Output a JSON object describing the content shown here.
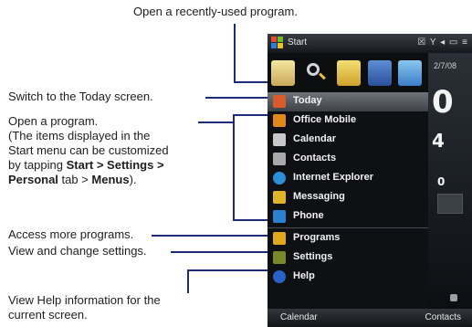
{
  "annotations": {
    "recent": "Open a recently-used program.",
    "today": "Switch to the Today screen.",
    "open_program": {
      "l1": "Open a program.",
      "l2": "(The items displayed in the",
      "l3": "Start menu can be customized",
      "l4_a": "by tapping ",
      "l4_b": "Start > Settings >",
      "l5_a": "Personal",
      "l5_b": " tab > ",
      "l5_c": "Menus",
      "l5_d": ")."
    },
    "programs": "Access more programs.",
    "settings": "View and change settings.",
    "help": {
      "l1": "View Help information for the",
      "l2": "current screen."
    }
  },
  "phone": {
    "title": "Start",
    "status_icons": "☒ Y ◂ ▭ ≡",
    "date": "2/7/08",
    "clock_digits": [
      "0",
      "4",
      "0"
    ],
    "menu": [
      {
        "label": "Today",
        "icon_color": "#d95a2a",
        "selected": true
      },
      {
        "label": "Office Mobile",
        "icon_color": "#e08a1e"
      },
      {
        "label": "Calendar",
        "icon_color": "#c8c8c8"
      },
      {
        "label": "Contacts",
        "icon_color": "#a8a8a8"
      },
      {
        "label": "Internet Explorer",
        "icon_color": "#2f8fd6"
      },
      {
        "label": "Messaging",
        "icon_color": "#e0b428"
      },
      {
        "label": "Phone",
        "icon_color": "#2d7fd0"
      },
      {
        "label": "Programs",
        "icon_color": "#e0a81e"
      },
      {
        "label": "Settings",
        "icon_color": "#7a8a2a"
      },
      {
        "label": "Help",
        "icon_color": "#2b62c8"
      }
    ],
    "recent_icons": [
      "notes-icon",
      "search-icon",
      "contacts-card-icon",
      "music-icon",
      "pictures-icon"
    ],
    "softkeys": {
      "left": "Calendar",
      "right": "Contacts"
    }
  }
}
